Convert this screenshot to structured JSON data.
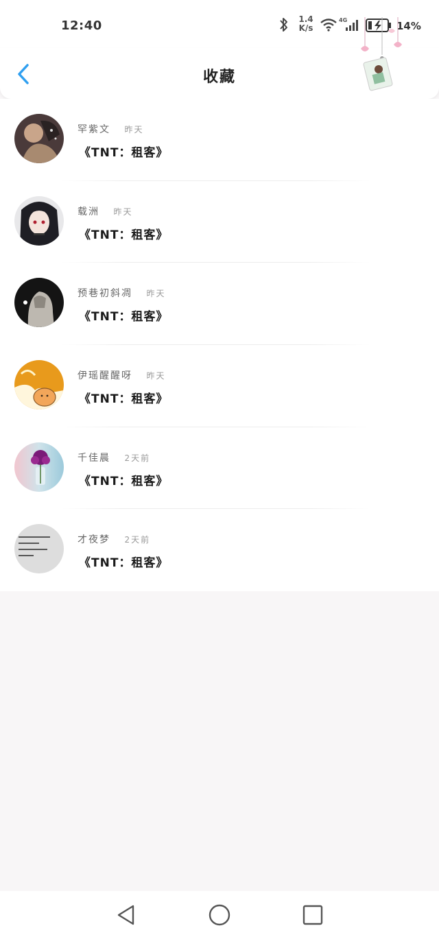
{
  "status_bar": {
    "time": "12:40",
    "speed_value": "1.4",
    "speed_unit": "K/s",
    "network_badge": "4G",
    "battery": "14%",
    "icons": [
      "bluetooth-icon",
      "wifi-icon",
      "signal-icon",
      "battery-charging-icon"
    ]
  },
  "header": {
    "title": "收藏",
    "back_icon": "chevron-left-icon",
    "accent_color": "#2f9ff0"
  },
  "favorites": [
    {
      "name": "罕紫文",
      "time": "昨天",
      "work": "《TNT：租客》",
      "avatar": "avatar-photo"
    },
    {
      "name": "载洲",
      "time": "昨天",
      "work": "《TNT：租客》",
      "avatar": "avatar-anime-girl"
    },
    {
      "name": "预巷初斜凋",
      "time": "昨天",
      "work": "《TNT：租客》",
      "avatar": "avatar-hooded-figure"
    },
    {
      "name": "伊瑶醒醒呀",
      "time": "昨天",
      "work": "《TNT：租客》",
      "avatar": "avatar-cartoon-cat"
    },
    {
      "name": "千佳晨",
      "time": "2天前",
      "work": "《TNT：租客》",
      "avatar": "avatar-flower-vase"
    },
    {
      "name": "才夜梦",
      "time": "2天前",
      "work": "《TNT：租客》",
      "avatar": "avatar-text-image"
    }
  ],
  "nav_bar": {
    "icons": [
      "back-triangle-icon",
      "home-circle-icon",
      "recents-square-icon"
    ]
  }
}
